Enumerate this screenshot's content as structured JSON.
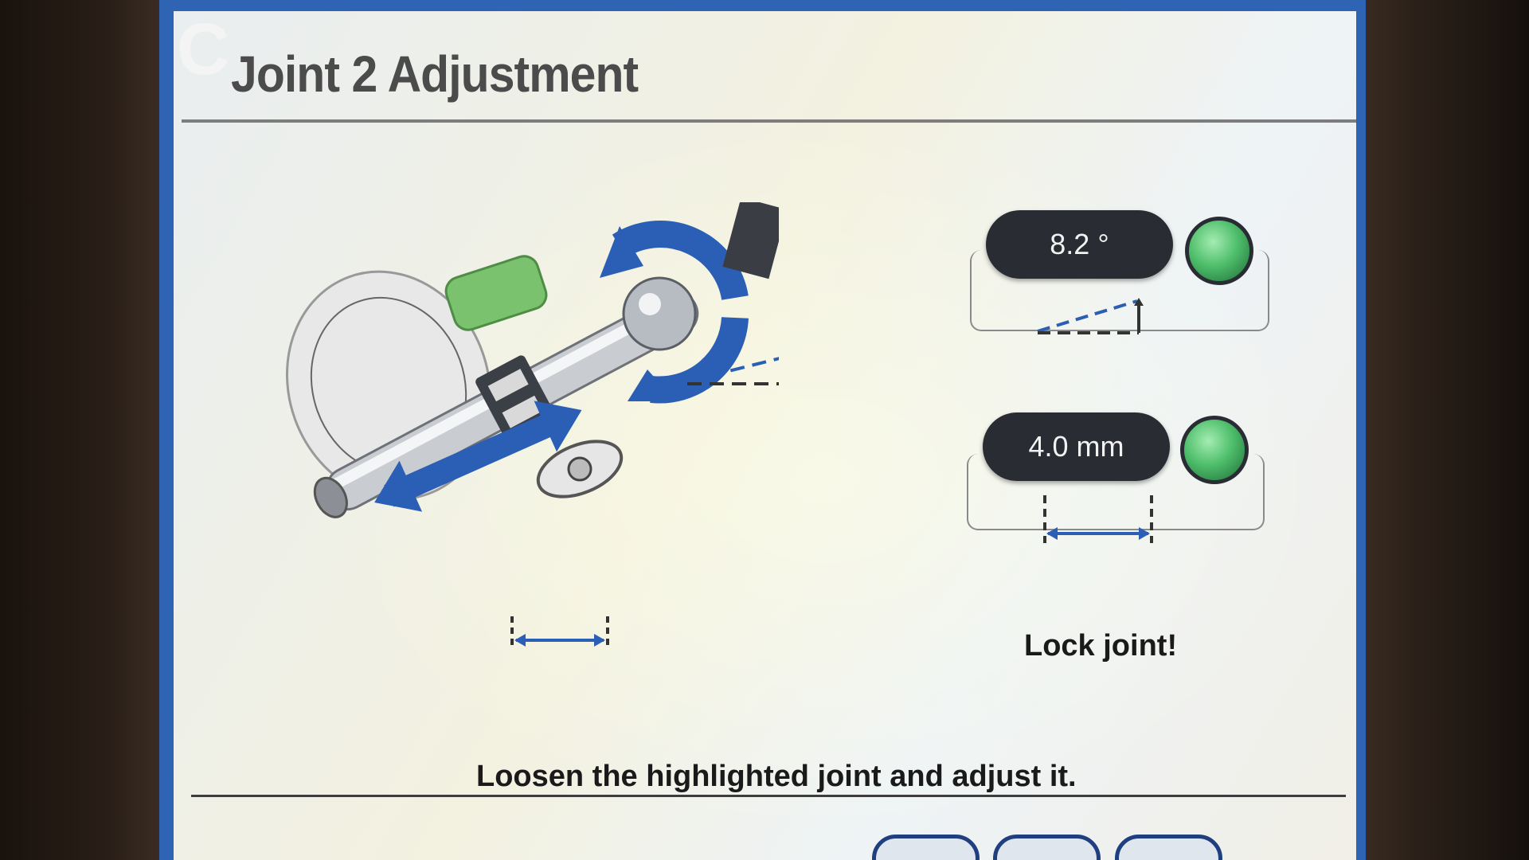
{
  "window": {
    "title": "Joint 2 Adjustment"
  },
  "readouts": {
    "angle": {
      "value": "8.2 °",
      "status": "ok"
    },
    "distance": {
      "value": "4.0 mm",
      "status": "ok"
    }
  },
  "status_text": "Lock joint!",
  "instruction": "Loosen the highlighted joint and adjust it.",
  "footer_buttons": [
    {
      "label": ""
    },
    {
      "label": ""
    },
    {
      "label": ""
    }
  ],
  "colors": {
    "frame_blue": "#2f63b3",
    "readout_bg": "#2a2c33",
    "status_green": "#4fbf6c",
    "arrow_blue": "#2a5fb5",
    "knob_green": "#7ac26e"
  },
  "icons": {
    "angle_indicator": "angle-triangle-icon",
    "distance_indicator": "distance-arrow-icon",
    "device": "needle-guide-device-illustration"
  }
}
